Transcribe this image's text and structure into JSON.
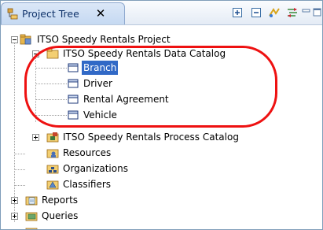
{
  "tab": {
    "label": "Project Tree",
    "close_glyph": "✕",
    "icon": "project-tree-icon"
  },
  "toolbar": {
    "buttons": [
      "expand-all-icon",
      "collapse-all-icon",
      "link-with-editor-icon",
      "filter-icon",
      "minimize-icon",
      "maximize-icon"
    ]
  },
  "tree": {
    "root": {
      "label": "ITSO Speedy Rentals Project",
      "icon": "project-icon",
      "expanded": true
    },
    "data_catalog": {
      "label": "ITSO Speedy Rentals Data Catalog",
      "icon": "data-catalog-icon",
      "expanded": true
    },
    "entities": [
      {
        "label": "Branch",
        "icon": "entity-icon",
        "selected": true
      },
      {
        "label": "Driver",
        "icon": "entity-icon",
        "selected": false
      },
      {
        "label": "Rental Agreement",
        "icon": "entity-icon",
        "selected": false
      },
      {
        "label": "Vehicle",
        "icon": "entity-icon",
        "selected": false
      }
    ],
    "process_catalog": {
      "label": "ITSO Speedy Rentals Process Catalog",
      "icon": "process-catalog-icon",
      "expanded": false
    },
    "resources": {
      "label": "Resources",
      "icon": "resources-icon"
    },
    "organizations": {
      "label": "Organizations",
      "icon": "organizations-icon"
    },
    "classifiers": {
      "label": "Classifiers",
      "icon": "classifiers-icon"
    },
    "reports": {
      "label": "Reports",
      "icon": "reports-icon",
      "expanded": false
    },
    "queries": {
      "label": "Queries",
      "icon": "queries-icon",
      "expanded": false
    }
  },
  "colors": {
    "selection": "#3169c6",
    "annotation_ring": "#ee1111",
    "tab_text": "#11346b"
  }
}
